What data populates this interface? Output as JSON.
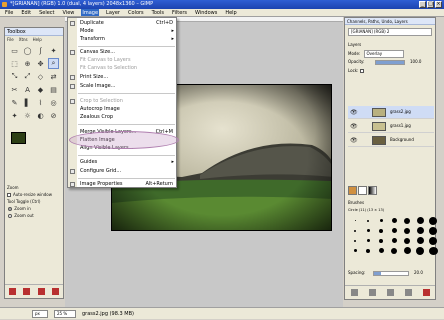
{
  "window": {
    "title": "*[GRIANAN] (RGB) 1.0 (dual, 4 layers) 2048x1360 – GIMP",
    "buttons": [
      "_",
      "□",
      "×"
    ]
  },
  "menubar": [
    "File",
    "Edit",
    "Select",
    "View",
    "Image",
    "Layer",
    "Colors",
    "Tools",
    "Filters",
    "Windows",
    "Help"
  ],
  "toolbox": {
    "title": "Toolbox",
    "menu": [
      "File",
      "Xtns",
      "Help"
    ],
    "tools": [
      "▭",
      "◯",
      "ʃ",
      "✦",
      "⬚",
      "⊕",
      "✥",
      "⌕",
      "⤡",
      "⤢",
      "◇",
      "⇄",
      "✂",
      "A",
      "◆",
      "▤",
      "✎",
      "▌",
      "⌇",
      "◎",
      "✦",
      "☼",
      "◐",
      "⊘"
    ],
    "foreground_color": "#2d3f15",
    "background_color": "#ffffff",
    "options_title": "Zoom",
    "auto_resize": "Auto-resize window",
    "tool_toggle": "Tool Toggle (Ctrl)",
    "zoom_in": "Zoom in",
    "zoom_out": "Zoom out"
  },
  "image_menu": {
    "items": [
      {
        "label": "Duplicate",
        "accel": "Ctrl+D",
        "disabled": false,
        "submenu": false
      },
      {
        "label": "Mode",
        "accel": "",
        "disabled": false,
        "submenu": true
      },
      {
        "label": "Transform",
        "accel": "",
        "disabled": false,
        "submenu": true
      },
      {
        "label": "Canvas Size...",
        "accel": "",
        "disabled": false,
        "submenu": false
      },
      {
        "label": "Fit Canvas to Layers",
        "accel": "",
        "disabled": true,
        "submenu": false
      },
      {
        "label": "Fit Canvas to Selection",
        "accel": "",
        "disabled": true,
        "submenu": false
      },
      {
        "label": "Print Size...",
        "accel": "",
        "disabled": false,
        "submenu": false
      },
      {
        "label": "Scale Image...",
        "accel": "",
        "disabled": false,
        "submenu": false
      },
      {
        "label": "Crop to Selection",
        "accel": "",
        "disabled": true,
        "submenu": false
      },
      {
        "label": "Autocrop Image",
        "accel": "",
        "disabled": false,
        "submenu": false
      },
      {
        "label": "Zealous Crop",
        "accel": "",
        "disabled": false,
        "submenu": false
      },
      {
        "label": "Merge Visible Layers...",
        "accel": "Ctrl+M",
        "disabled": false,
        "submenu": false
      },
      {
        "label": "Flatten Image",
        "accel": "",
        "disabled": false,
        "submenu": false
      },
      {
        "label": "Align Visible Layers...",
        "accel": "",
        "disabled": false,
        "submenu": false
      },
      {
        "label": "Guides",
        "accel": "",
        "disabled": false,
        "submenu": true
      },
      {
        "label": "Configure Grid...",
        "accel": "",
        "disabled": false,
        "submenu": false
      },
      {
        "label": "Image Properties",
        "accel": "Alt+Return",
        "disabled": false,
        "submenu": false
      }
    ]
  },
  "layers_panel": {
    "title": "Channels, Paths, Undo, Layers",
    "image_selector": "[GRIANAN] (RGB) 2",
    "tab_label": "Layers",
    "mode_label": "Mode:",
    "mode_value": "Overlay",
    "opacity_label": "Opacity:",
    "opacity_value": "100.0",
    "lock_label": "Lock:",
    "layers": [
      {
        "name": "grass2.jpg",
        "selected": true,
        "thumb": "#b8b080"
      },
      {
        "name": "grass1.jpg",
        "selected": false,
        "thumb": "#c8c090"
      },
      {
        "name": "Background",
        "selected": false,
        "thumb": "#6a6040"
      }
    ],
    "brushes_label": "Brushes",
    "brush_name": "Circle (11) (13 × 13)",
    "spacing_label": "Spacing:",
    "spacing_value": "20.0"
  },
  "statusbar": {
    "unit": "px",
    "zoom": "25 %",
    "text": "grass2.jpg (98.3 MB)"
  }
}
